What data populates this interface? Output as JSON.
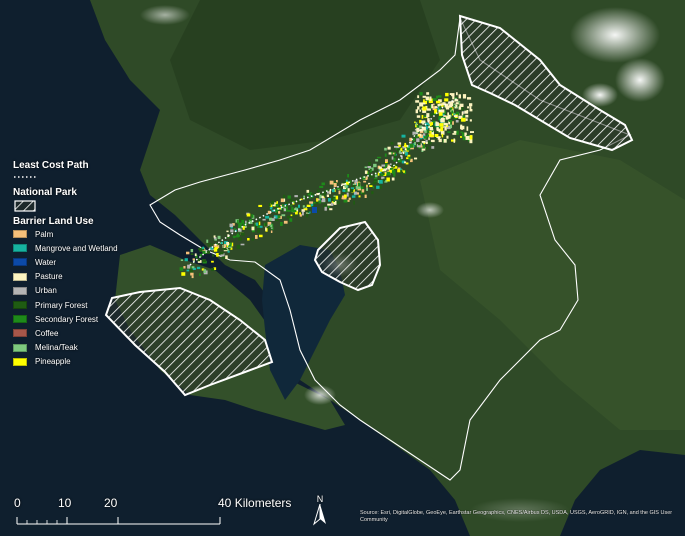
{
  "legend": {
    "least_cost_path": "Least Cost Path",
    "national_park": "National Park",
    "barrier_title": "Barrier Land Use",
    "barrier_items": [
      {
        "label": "Palm",
        "color": "#f5c07a"
      },
      {
        "label": "Mangrove and Wetland",
        "color": "#16b3a0"
      },
      {
        "label": "Water",
        "color": "#0c4aa8"
      },
      {
        "label": "Pasture",
        "color": "#fdf4c0"
      },
      {
        "label": "Urban",
        "color": "#b4b4b4"
      },
      {
        "label": "Primary Forest",
        "color": "#1f5c12"
      },
      {
        "label": "Secondary Forest",
        "color": "#1e8a1a"
      },
      {
        "label": "Coffee",
        "color": "#a8574a"
      },
      {
        "label": "Melina/Teak",
        "color": "#7ec97e"
      },
      {
        "label": "Pineapple",
        "color": "#ffff00"
      }
    ]
  },
  "scale_bar": {
    "ticks": [
      "0",
      "10",
      "20",
      "40"
    ],
    "units": "Kilometers"
  },
  "north_arrow": {
    "letter": "N"
  },
  "attribution": "Source: Esri, DigitalGlobe, GeoEye, Earthstar Geographics, CNES/Airbus DS, USDA, USGS, AeroGRID, IGN, and the GIS User Community",
  "colors": {
    "ocean": "#0f1f2e",
    "land": "#2f4a27",
    "boundary": "#ffffff",
    "path": "#ffffff"
  }
}
